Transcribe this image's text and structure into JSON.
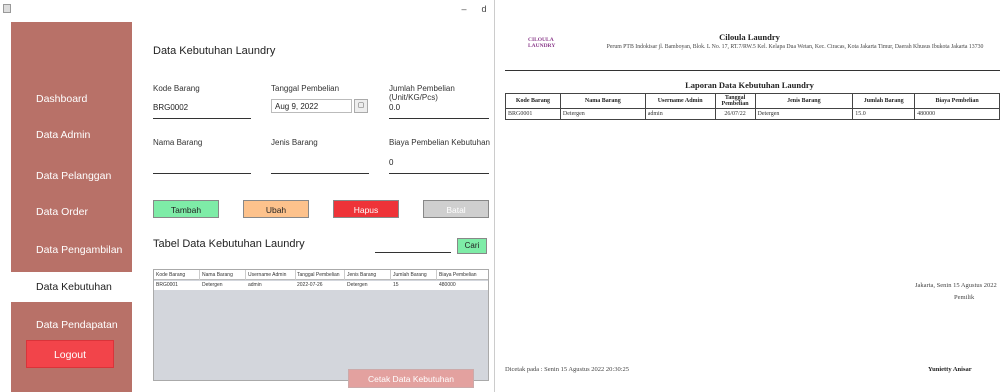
{
  "window": {
    "minimize_glyph": "–",
    "maximize_glyph": "d"
  },
  "sidebar": {
    "items": [
      {
        "label": "Dashboard"
      },
      {
        "label": "Data Admin"
      },
      {
        "label": "Data Pelanggan"
      },
      {
        "label": "Data Order"
      },
      {
        "label": "Data Pengambilan"
      },
      {
        "label": "Data Kebutuhan"
      },
      {
        "label": "Data Pendapatan"
      }
    ],
    "active": "Data Kebutuhan",
    "logout_label": "Logout"
  },
  "form": {
    "title": "Data Kebutuhan Laundry",
    "kode_barang_label": "Kode Barang",
    "kode_barang_value": "BRG0002",
    "tanggal_label": "Tanggal Pembelian",
    "tanggal_value": "Aug 9, 2022",
    "jumlah_label": "Jumlah Pembelian (Unit/KG/Pcs)",
    "jumlah_value": "0.0",
    "nama_label": "Nama Barang",
    "nama_value": "",
    "jenis_label": "Jenis Barang",
    "jenis_value": "",
    "biaya_label": "Biaya Pembelian Kebutuhan",
    "biaya_value": "0"
  },
  "buttons": {
    "tambah": "Tambah",
    "ubah": "Ubah",
    "hapus": "Hapus",
    "batal": "Batal",
    "cari": "Cari",
    "cetak": "Cetak Data Kebutuhan"
  },
  "table": {
    "title": "Tabel Data Kebutuhan Laundry",
    "columns": [
      "Kode Barang",
      "Nama Barang",
      "Username Admin",
      "Tanggal Pembelian",
      "Jenis Barang",
      "Jumlah Barang",
      "Biaya Pembelian"
    ],
    "rows": [
      [
        "BRG0001",
        "Detergen",
        "admin",
        "2022-07-26",
        "Detergen",
        "15",
        "480000"
      ]
    ]
  },
  "report": {
    "logo_text": "CILOULA LAUNDRY",
    "company_name": "Ciloula Laundry",
    "company_address": "Perum PTB Indokisar jl. Bamboyan, Blok. L No. 17, RT.7/RW.5 Kel. Kelapa Dua Wetan, Kec. Ciracas, Kota Jakarta Timur, Daerah Khusus Ibukota Jakarta 13730",
    "title": "Laporan Data Kebutuhan Laundry",
    "columns": [
      "Kode Barang",
      "Nama Barang",
      "Username Admin",
      "Tanggal Pembelian",
      "Jenis Barang",
      "Jumlah Barang",
      "Biaya Pembelian"
    ],
    "rows": [
      [
        "BRG0001",
        "Detergen",
        "admin",
        "26/07/22",
        "Detergen",
        "15.0",
        "480000"
      ]
    ],
    "sign_date": "Jakarta,  Senin 15 Agustus 2022",
    "sign_title": "Pemilik",
    "printed_at": "Dicetak pada  :  Senin 15 Agustus 2022 20:30:25",
    "owner_name": "Yunietty Anisar"
  },
  "colors": {
    "sidebar": "#b87168",
    "tambah": "#7eeca7",
    "ubah": "#fdc28c",
    "hapus": "#ee3338",
    "batal": "#cfcfcf",
    "cetak": "#e3a19f",
    "logout": "#f2444a"
  }
}
